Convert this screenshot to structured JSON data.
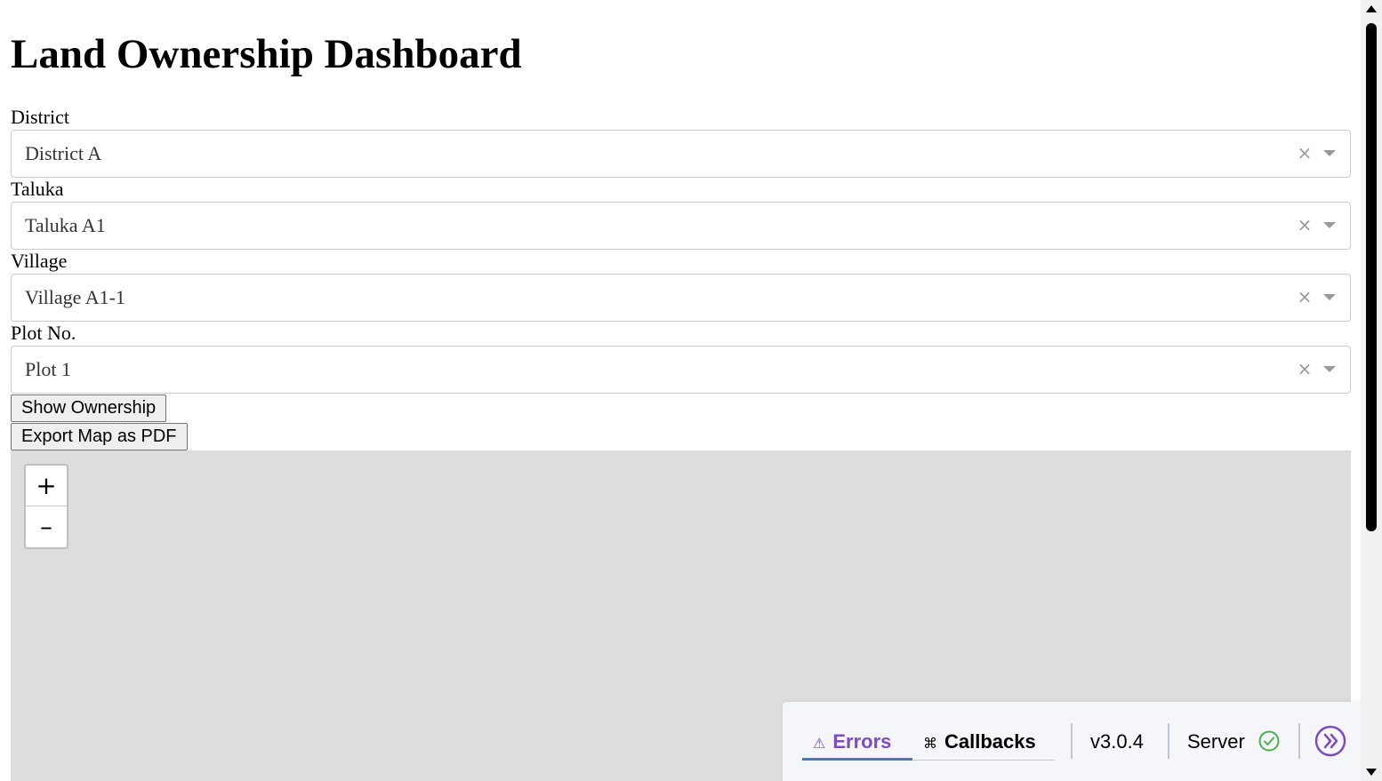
{
  "page": {
    "title": "Land Ownership Dashboard"
  },
  "filters": [
    {
      "label": "District",
      "value": "District A"
    },
    {
      "label": "Taluka",
      "value": "Taluka A1"
    },
    {
      "label": "Village",
      "value": "Village A1-1"
    },
    {
      "label": "Plot No.",
      "value": "Plot 1"
    }
  ],
  "select_icons": {
    "clear": "×",
    "clear_icon_name": "close-icon",
    "arrow_icon_name": "caret-down-icon"
  },
  "buttons": {
    "show_ownership": "Show Ownership",
    "export_pdf": "Export Map as PDF"
  },
  "map": {
    "zoom_in": "+",
    "zoom_out": "–",
    "background_color": "#dddddd"
  },
  "dash_debug": {
    "errors_label": "Errors",
    "errors_icon": "⚠",
    "callbacks_label": "Callbacks",
    "callbacks_icon": "⌘",
    "version": "v3.0.4",
    "server_label": "Server",
    "accent_color": "#7f4bc4",
    "server_ok_color": "#4caf50"
  }
}
